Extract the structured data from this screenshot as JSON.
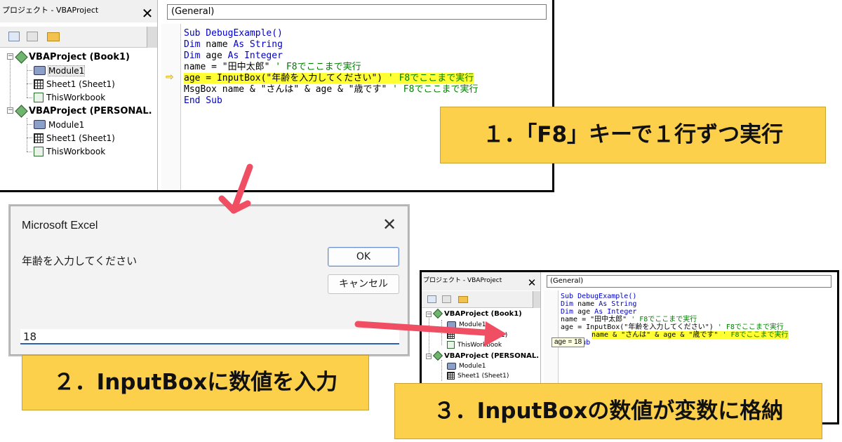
{
  "window1": {
    "project_title": "プロジェクト - VBAProject",
    "close_glyph": "✕",
    "combo_label": "(General)",
    "tree": {
      "project1": "VBAProject (Book1)",
      "module1": "Module1",
      "sheet1": "Sheet1 (Sheet1)",
      "thisworkbook": "ThisWorkbook",
      "project2": "VBAProject (PERSONAL.",
      "module2": "Module1",
      "sheet2": "Sheet1 (Sheet1)",
      "thisworkbook2": "ThisWorkbook"
    },
    "code": {
      "l1": "Sub DebugExample()",
      "l2_kw": "Dim",
      "l2_mid": " name ",
      "l2_kw2": "As String",
      "l3_kw": "Dim",
      "l3_mid": " age ",
      "l3_kw2": "As Integer",
      "l4_code": "name = \"田中太郎\"",
      "l4_cm": " ' F8でここまで実行",
      "l5_code": "age = InputBox(\"年齢を入力してください\")",
      "l5_cm": " ' F8でここまで実行",
      "l6_code": "MsgBox name & \"さんは\" & age & \"歳です\"",
      "l6_cm": " ' F8でここまで実行",
      "l7": "End Sub"
    },
    "exec_arrow": "⇨"
  },
  "dialog": {
    "title": "Microsoft Excel",
    "close_glyph": "✕",
    "prompt": "年齢を入力してください",
    "ok_label": "OK",
    "cancel_label": "キャンセル",
    "input_value": "18"
  },
  "window2": {
    "project_title": "プロジェクト - VBAProject",
    "close_glyph": "✕",
    "combo_label": "(General)",
    "tree": {
      "project1": "VBAProject (Book1)",
      "module1": "Module1",
      "sheet1_tail": "1)",
      "thisworkbook": "ThisWorkbook",
      "project2": "VBAProject (PERSONAL.",
      "module2": "Module1",
      "sheet2": "Sheet1 (Sheet1)"
    },
    "code": {
      "l1": "Sub DebugExample()",
      "l2_kw": "Dim",
      "l2_mid": " name ",
      "l2_kw2": "As String",
      "l3_kw": "Dim",
      "l3_mid": " age ",
      "l3_kw2": "As Integer",
      "l4_code": "name = \"田中太郎\"",
      "l4_cm": " ' F8でここまで実行",
      "l5_code": "age = InputBox(\"年齢を入力してください\")",
      "l5_cm": " ' F8でここまで実行",
      "l6_code": "name & \"さんは\" & age & \"歳です\"",
      "l6_cm": " ' F8でここまで実行",
      "l7": "End Sub"
    },
    "tooltip": "age = 18"
  },
  "labels": {
    "step1": "１．「F8」キーで１行ずつ実行",
    "step2": "２．InputBoxに数値を入力",
    "step3": "３．InputBoxの数値が変数に格納"
  },
  "colors": {
    "label_bg": "#fdd04c",
    "highlight": "#ffff33",
    "arrow": "#f04e62",
    "keyword": "#0000cc",
    "comment": "#008000"
  }
}
